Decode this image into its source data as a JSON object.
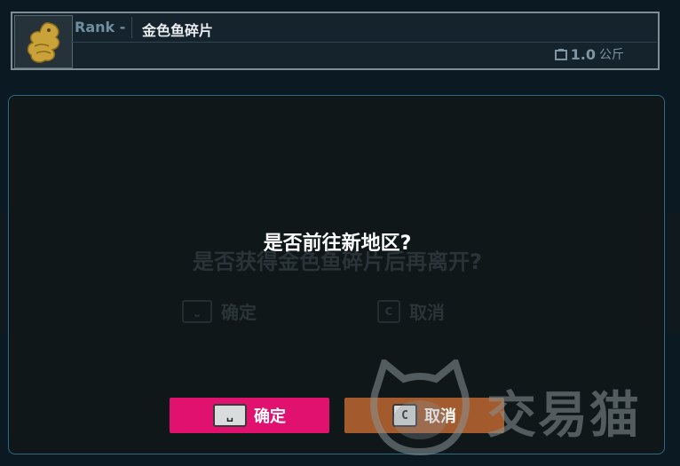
{
  "item": {
    "rank_label": "Rank -",
    "name": "金色鱼碎片",
    "weight_value": "1.0",
    "weight_unit": "公斤"
  },
  "dialog": {
    "title": "是否前往新地区?",
    "background_prompt": "是否获得金色鱼碎片后再离开?",
    "background_confirm": "确定",
    "background_cancel": "取消",
    "confirm_key": "␣",
    "confirm_label": "确定",
    "cancel_key": "C",
    "cancel_label": "取消"
  },
  "watermark": {
    "text": "交易猫"
  },
  "colors": {
    "confirm": "#e0116f",
    "cancel": "#a35a2c",
    "dialog_border": "#2e6b8a"
  },
  "icons": {
    "item": "golden-fish-icon",
    "weight": "weight-icon",
    "watermark": "cat-logo-icon"
  }
}
